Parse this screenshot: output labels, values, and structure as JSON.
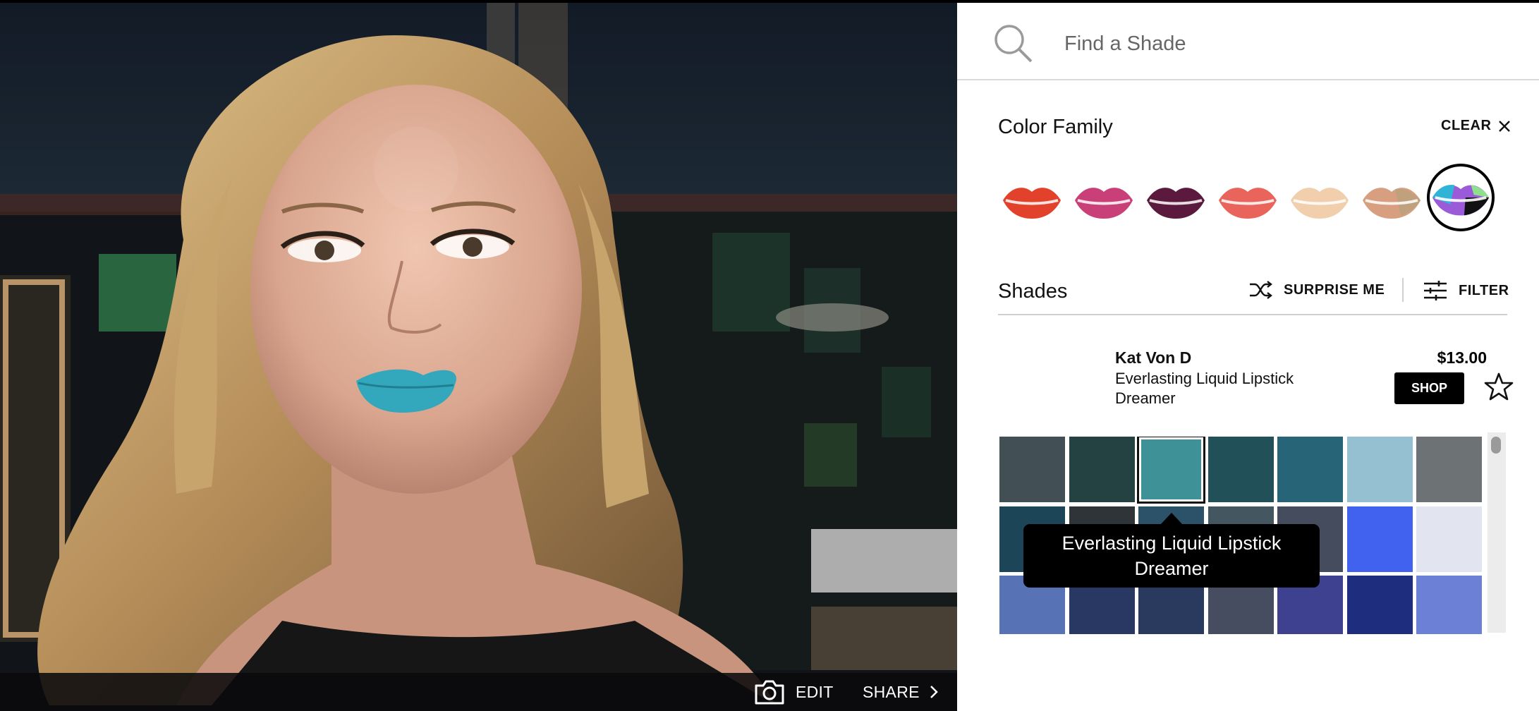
{
  "camera": {
    "edit_label": "EDIT",
    "share_label": "SHARE"
  },
  "search": {
    "placeholder": "Find a Shade"
  },
  "color_family": {
    "title": "Color Family",
    "clear_label": "CLEAR",
    "families": [
      {
        "color": "#e2412b",
        "selected": false
      },
      {
        "color": "#c93f77",
        "selected": false
      },
      {
        "color": "#5b1a3d",
        "selected": false
      },
      {
        "color": "#e9655c",
        "selected": false
      },
      {
        "color": "#f1cfad",
        "selected": false
      },
      {
        "color": "#d79f80",
        "selected": false
      },
      {
        "color": "multi",
        "selected": true
      }
    ]
  },
  "shades": {
    "title": "Shades",
    "surprise_label": "SURPRISE ME",
    "filter_label": "FILTER"
  },
  "product": {
    "brand": "Kat Von D",
    "name": "Everlasting Liquid Lipstick",
    "shade": "Dreamer",
    "price": "$13.00",
    "shop_label": "SHOP"
  },
  "swatches": [
    [
      "#424f55",
      "#234241",
      "#3e9197",
      "#215058",
      "#286478",
      "#94c0d2",
      "#6d7274"
    ],
    [
      "#1c4658",
      "#2e3438",
      "#2b5268",
      "#445660",
      "#444c5e",
      "#4062ef",
      "#e2e5f0"
    ],
    [
      "#5773b6",
      "#283862",
      "#2a3a5e",
      "#474d60",
      "#3d418f",
      "#1f2d7f",
      "#6c80d6"
    ]
  ],
  "tooltip": {
    "line1": "Everlasting Liquid Lipstick",
    "line2": "Dreamer"
  }
}
